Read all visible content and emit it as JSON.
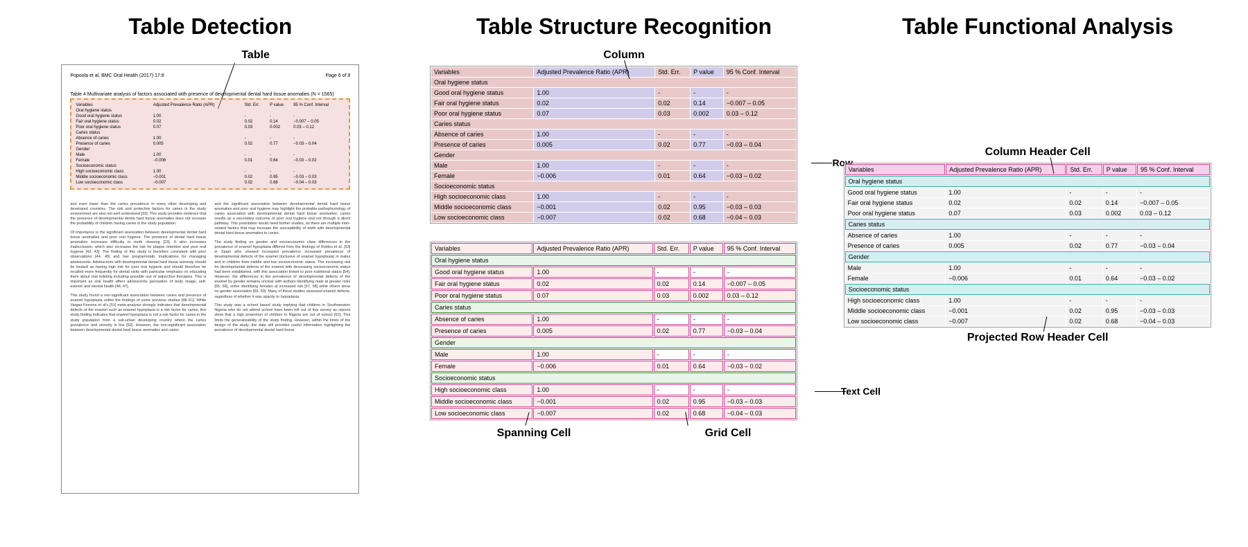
{
  "titles": {
    "detection": "Table Detection",
    "structure": "Table Structure Recognition",
    "functional": "Table Functional Analysis"
  },
  "annotations": {
    "table": "Table",
    "column": "Column",
    "row": "Row",
    "text_cell": "Text Cell",
    "grid_cell": "Grid Cell",
    "spanning_cell": "Spanning Cell",
    "col_header_cell": "Column Header Cell",
    "proj_row_header": "Projected Row Header Cell"
  },
  "doc": {
    "running_head": "Popoola et al. BMC Oral Health (2017) 17:8",
    "page_no": "Page 6 of 8",
    "table_caption": "Table 4 Multivariate analysis of factors associated with presence of developmental dental hard tissue anomalies (N = 1565)",
    "para1": "and even lower than the caries prevalence in many other developing and developed countries. The risk and protective factors for caries in the study environment are also not well understood [32]. This study provides evidence that the presence of developmental dental hard tissue anomalies does not increase the probability of children having caries in the study population.",
    "para2": "Of importance is the significant association between developmental dental hard tissue anomalies and poor oral hygiene. The presence of dental hard tissue anomalies increases difficulty in tooth cleaning [23]. It also increases malocclusion, which also increases the risk for plaque retention and poor oral hygiene [42, 43]. The finding of this study is therefore consistent with prior observations [44, 45] and has programmatic implications for managing adolescents. Adolescents with developmental dental hard tissue anomaly should be treated as having high risk for poor oral hygiene and should therefore be recalled more frequently for dental visits with particular emphasis on educating them about oral toileting including possible use of adjunctive therapies. This is important as oral health affect adolescents perception of body image, self-esteem and mental health [46, 47].",
    "para3": "This study found a non-significant association between caries and presence of enamel hypoplasia unlike the findings of some previous studies [48–51]. While Vargas-Ferreira et al's [51] meta-analysis strongly indicates that developmental defects of the enamel such as enamel hypoplasia is a risk factor for caries, this study finding indicates that enamel hypoplasia is not a risk factor for caries in the study population from a sub-urban developing country where the caries prevalence and severity is low [52]. However, the non-significant association between developmental dental hard tissue anomalies and caries",
    "para4": "and the significant association between developmental dental hard tissue anomalies and poor oral hygiene may highlight the probable pathophysiology of caries associated with developmental dental hard tissue anomalies: caries results as a secondary outcome of poor oral hygiene and not through a direct pathway. This postulation would need further studies, as there are multiple inter-related factors that may increase the susceptibility of teeth with developmental dental hard tissue anomalies to caries.",
    "para5": "The study finding on gender and socioeconomic class differences in the prevalence of enamel hypoplasia differed from the findings of Robles et al. [53] in Spain who showed increased prevalence increased prevalence of developmental defects of the enamel (inclusive of enamel hypoplasia) in males and in children from middle and low socioeconomic status. The increasing risk for developmental defects of the enamel with decreasing socioeconomic status had been established, with this association linked to poor nutritional status [54]. However, the differences in the prevalence of developmental defects of the enamel by gender remains unclear with authors identifying male at greater risks [55, 56], some identifying females at increased risk [57, 58] while others show no gender association [59, 60]. Many of these studies assessed enamel defects, regardless of whether it was opacity or hypoplasia.",
    "para6": "This study was a school based study implying that children in Southwestern Nigeria who do not attend school have been left out of this survey as reports show that a high proportion of children in Nigeria are out of school [61]. This limits the generalizability of the study finding. However, within the limits of the design of the study, the data still provides useful information highlighting the prevalence of developmental dental hard tissue"
  },
  "table": {
    "headers": [
      "Variables",
      "Adjusted Prevalence Ratio (APR)",
      "Std. Err.",
      "P value",
      "95 % Conf. Interval"
    ],
    "sections": [
      {
        "name": "Oral hygiene status",
        "rows": [
          {
            "label": "Good oral hygiene status",
            "apr": "1.00",
            "se": "-",
            "p": "-",
            "ci": "-"
          },
          {
            "label": "Fair oral hygiene status",
            "apr": "0.02",
            "se": "0.02",
            "p": "0.14",
            "ci": "−0.007 – 0.05"
          },
          {
            "label": "Poor oral hygiene status",
            "apr": "0.07",
            "se": "0.03",
            "p": "0.002",
            "ci": "0.03 – 0.12"
          }
        ]
      },
      {
        "name": "Caries status",
        "rows": [
          {
            "label": "Absence of caries",
            "apr": "1.00",
            "se": "-",
            "p": "-",
            "ci": "-"
          },
          {
            "label": "Presence of caries",
            "apr": "0.005",
            "se": "0.02",
            "p": "0.77",
            "ci": "−0.03 – 0.04"
          }
        ]
      },
      {
        "name": "Gender",
        "rows": [
          {
            "label": "Male",
            "apr": "1.00",
            "se": "-",
            "p": "-",
            "ci": "-"
          },
          {
            "label": "Female",
            "apr": "−0.006",
            "se": "0.01",
            "p": "0.64",
            "ci": "−0.03 – 0.02"
          }
        ]
      },
      {
        "name": "Socioeconomic status",
        "rows": [
          {
            "label": "High socioeconomic class",
            "apr": "1.00",
            "se": "-",
            "p": "-",
            "ci": "-"
          },
          {
            "label": "Middle socioeconomic class",
            "apr": "−0.001",
            "se": "0.02",
            "p": "0.95",
            "ci": "−0.03 – 0.03"
          },
          {
            "label": "Low socioeconomic class",
            "apr": "−0.007",
            "se": "0.02",
            "p": "0.68",
            "ci": "−0.04 – 0.03"
          }
        ]
      }
    ]
  }
}
